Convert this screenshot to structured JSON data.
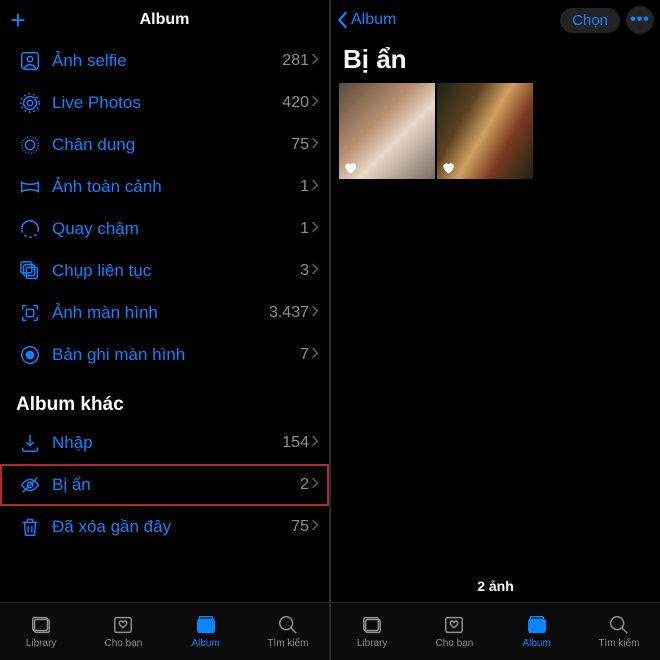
{
  "left": {
    "header": {
      "title": "Album"
    },
    "rows": [
      {
        "icon": "person-square-icon",
        "label": "Ảnh selfie",
        "count": "281"
      },
      {
        "icon": "live-photos-icon",
        "label": "Live Photos",
        "count": "420"
      },
      {
        "icon": "portrait-icon",
        "label": "Chân dung",
        "count": "75"
      },
      {
        "icon": "panorama-icon",
        "label": "Ảnh toàn cảnh",
        "count": "1"
      },
      {
        "icon": "slo-mo-icon",
        "label": "Quay chậm",
        "count": "1"
      },
      {
        "icon": "burst-icon",
        "label": "Chụp liên tục",
        "count": "3"
      },
      {
        "icon": "screenshot-icon",
        "label": "Ảnh màn hình",
        "count": "3.437"
      },
      {
        "icon": "screen-recording-icon",
        "label": "Bản ghi màn hình",
        "count": "7"
      }
    ],
    "section_other": "Album khác",
    "other_rows": [
      {
        "icon": "import-icon",
        "label": "Nhập",
        "count": "154",
        "highlight": false
      },
      {
        "icon": "hidden-icon",
        "label": "Bị ẩn",
        "count": "2",
        "highlight": true
      },
      {
        "icon": "trash-icon",
        "label": "Đã xóa gần đây",
        "count": "75",
        "highlight": false
      }
    ]
  },
  "right": {
    "back_label": "Album",
    "select_label": "Chọn",
    "title": "Bị ẩn",
    "photo_count_label": "2 ảnh"
  },
  "tabs": [
    {
      "icon": "library-tab-icon",
      "label": "Library"
    },
    {
      "icon": "foryou-tab-icon",
      "label": "Cho bạn"
    },
    {
      "icon": "albums-tab-icon",
      "label": "Album",
      "active": true
    },
    {
      "icon": "search-tab-icon",
      "label": "Tìm kiếm"
    }
  ]
}
